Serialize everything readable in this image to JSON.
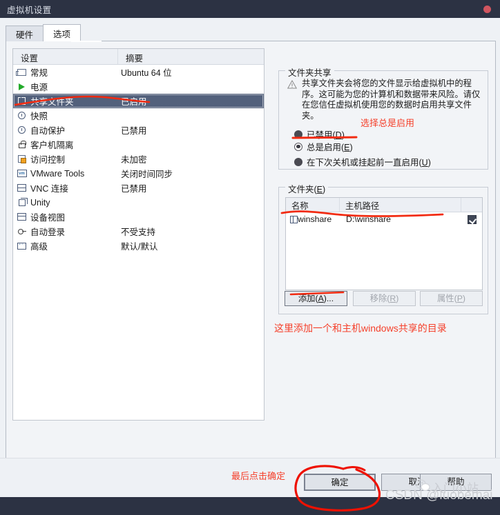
{
  "window": {
    "title": "虚拟机设置",
    "close_icon": "close-dot-icon",
    "accent_dark": "#2c3243",
    "close_color": "#d0555f"
  },
  "tabs": [
    {
      "label": "硬件",
      "active": false
    },
    {
      "label": "选项",
      "active": true
    }
  ],
  "settings_list": {
    "columns": [
      "设置",
      "摘要"
    ],
    "rows": [
      {
        "icon": "monitor-icon",
        "name": "常规",
        "summary": "Ubuntu 64 位",
        "selected": false
      },
      {
        "icon": "play-icon",
        "name": "电源",
        "summary": "",
        "selected": false
      },
      {
        "icon": "shared-folder-icon",
        "name": "共享文件夹",
        "summary": "已启用",
        "selected": true
      },
      {
        "icon": "snapshot-clock-icon",
        "name": "快照",
        "summary": "",
        "selected": false
      },
      {
        "icon": "autoprotect-icon",
        "name": "自动保护",
        "summary": "已禁用",
        "selected": false
      },
      {
        "icon": "lock-icon",
        "name": "客户机隔离",
        "summary": "",
        "selected": false
      },
      {
        "icon": "access-control-icon",
        "name": "访问控制",
        "summary": "未加密",
        "selected": false
      },
      {
        "icon": "vmware-tools-icon",
        "name": "VMware Tools",
        "summary": "关闭时间同步",
        "selected": false
      },
      {
        "icon": "vnc-icon",
        "name": "VNC 连接",
        "summary": "已禁用",
        "selected": false
      },
      {
        "icon": "unity-icon",
        "name": "Unity",
        "summary": "",
        "selected": false
      },
      {
        "icon": "device-view-icon",
        "name": "设备视图",
        "summary": "",
        "selected": false
      },
      {
        "icon": "autologin-key-icon",
        "name": "自动登录",
        "summary": "不受支持",
        "selected": false
      },
      {
        "icon": "advanced-icon",
        "name": "高级",
        "summary": "默认/默认",
        "selected": false
      }
    ]
  },
  "folder_sharing": {
    "legend": "文件夹共享",
    "warning_icon": "warning-triangle-icon",
    "warning_text": "共享文件夹会将您的文件显示给虚拟机中的程序。这可能为您的计算机和数据带来风险。请仅在您信任虚拟机使用您的数据时启用共享文件夹。",
    "options": [
      {
        "label": "已禁用(D)",
        "mnemonic": "D",
        "text_before": "已禁用(",
        "text_after": ")",
        "checked": false
      },
      {
        "label": "总是启用(E)",
        "mnemonic": "E",
        "text_before": "总是启用(",
        "text_after": ")",
        "checked": true
      },
      {
        "label": "在下次关机或挂起前一直启用(U)",
        "mnemonic": "U",
        "text_before": "在下次关机或挂起前一直启用(",
        "text_after": ")",
        "checked": false
      }
    ]
  },
  "folders": {
    "legend": "文件夹(E)",
    "legend_before": "文件夹(",
    "legend_mnemonic": "E",
    "legend_after": ")",
    "columns": [
      "名称",
      "主机路径"
    ],
    "rows": [
      {
        "icon": "folder-icon",
        "name": "winshare",
        "path": "D:\\winshare",
        "enabled": true
      }
    ],
    "buttons": [
      {
        "label": "添加(A)...",
        "before": "添加(",
        "mnemonic": "A",
        "after": ")...",
        "enabled": true,
        "name": "add-folder-button"
      },
      {
        "label": "移除(R)",
        "before": "移除(",
        "mnemonic": "R",
        "after": ")",
        "enabled": false,
        "name": "remove-folder-button"
      },
      {
        "label": "属性(P)",
        "before": "属性(",
        "mnemonic": "P",
        "after": ")",
        "enabled": false,
        "name": "folder-properties-button"
      }
    ]
  },
  "dialog_buttons": [
    {
      "label": "确定",
      "name": "ok-button",
      "default": true
    },
    {
      "label": "取消",
      "name": "cancel-button",
      "default": false
    },
    {
      "label": "帮助",
      "name": "help-button",
      "default": false
    }
  ],
  "annotations": {
    "color": "#f5402b",
    "select_always": "选择总是启用",
    "add_share_dir": "这里添加一个和主机windows共享的目录",
    "click_ok": "最后点击确定"
  },
  "watermarks": {
    "csdn": "CSDN @luobemai",
    "site": "入门小站",
    "wechat_icon": "wechat-icon",
    "color": "#cfd2d6"
  }
}
